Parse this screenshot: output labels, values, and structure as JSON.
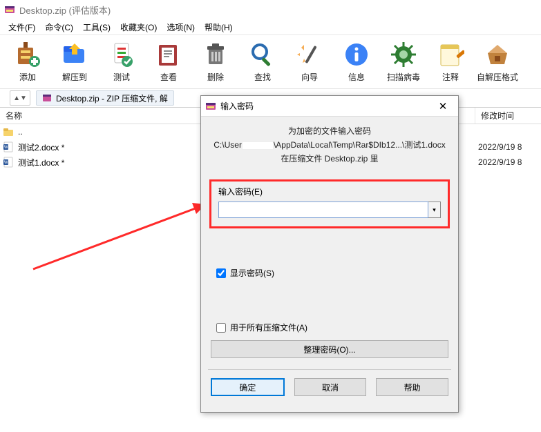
{
  "titlebar": {
    "title": "Desktop.zip (评估版本)"
  },
  "menubar": [
    "文件(F)",
    "命令(C)",
    "工具(S)",
    "收藏夹(O)",
    "选项(N)",
    "帮助(H)"
  ],
  "toolbar": [
    {
      "name": "add",
      "label": "添加"
    },
    {
      "name": "extract",
      "label": "解压到"
    },
    {
      "name": "test",
      "label": "测试"
    },
    {
      "name": "view",
      "label": "查看"
    },
    {
      "name": "delete",
      "label": "删除"
    },
    {
      "name": "find",
      "label": "查找"
    },
    {
      "name": "wizard",
      "label": "向导"
    },
    {
      "name": "info",
      "label": "信息"
    },
    {
      "name": "virusscan",
      "label": "扫描病毒"
    },
    {
      "name": "comment",
      "label": "注释"
    },
    {
      "name": "sfx",
      "label": "自解压格式"
    }
  ],
  "tab": {
    "label": "Desktop.zip - ZIP 压缩文件, 解"
  },
  "list": {
    "headers": {
      "name": "名称",
      "date": "修改时间"
    },
    "updir": "..",
    "rows": [
      {
        "name": "测试2.docx *",
        "date": "2022/9/19 8"
      },
      {
        "name": "测试1.docx *",
        "date": "2022/9/19 8"
      }
    ]
  },
  "dialog": {
    "title": "输入密码",
    "close": "✕",
    "msg1": "为加密的文件输入密码",
    "path_prefix": "C:\\User",
    "path_suffix": "\\AppData\\Local\\Temp\\Rar$DIb12...\\测试1.docx",
    "msg3": "在压缩文件 Desktop.zip 里",
    "pw_label": "输入密码(E)",
    "pw_value": "",
    "show_pw": "显示密码(S)",
    "all_archives": "用于所有压缩文件(A)",
    "organize": "整理密码(O)...",
    "ok": "确定",
    "cancel": "取消",
    "help": "帮助"
  }
}
